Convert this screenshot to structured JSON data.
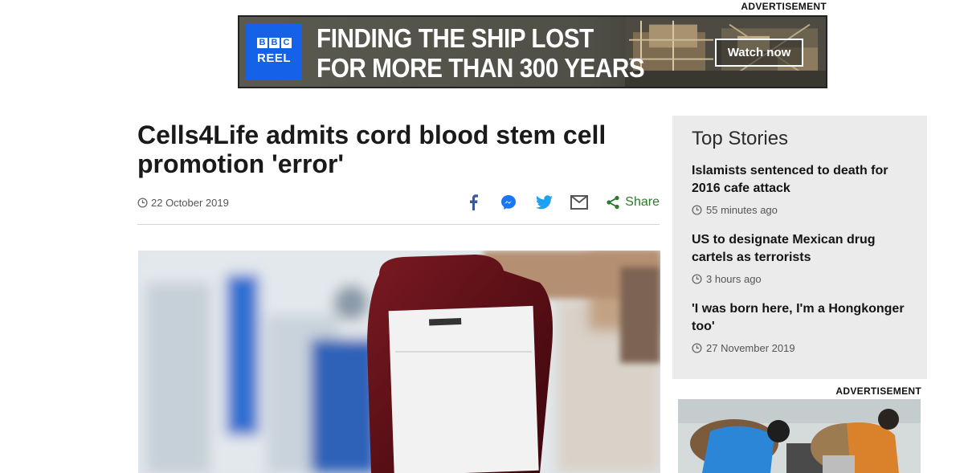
{
  "top_ad": {
    "label": "ADVERTISEMENT",
    "brand_blocks": [
      "B",
      "B",
      "C"
    ],
    "brand_name": "REEL",
    "headline_line1": "FINDING THE SHIP LOST",
    "headline_line2": "FOR MORE THAN 300 YEARS",
    "cta": "Watch now",
    "brand_color": "#1562e8"
  },
  "article": {
    "headline": "Cells4Life admits cord blood stem cell promotion 'error'",
    "date": "22 October 2019",
    "share_label": "Share",
    "social_icons": [
      "facebook-icon",
      "messenger-icon",
      "twitter-icon",
      "email-icon",
      "share-icon"
    ],
    "share_color": "#2a7a2a"
  },
  "sidebar": {
    "title": "Top Stories",
    "stories": [
      {
        "title": "Islamists sentenced to death for 2016 cafe attack",
        "time": "55 minutes ago"
      },
      {
        "title": "US to designate Mexican drug cartels as terrorists",
        "time": "3 hours ago"
      },
      {
        "title": "'I was born here, I'm a Hongkonger too'",
        "time": "27 November 2019"
      }
    ],
    "ad_label": "ADVERTISEMENT"
  }
}
